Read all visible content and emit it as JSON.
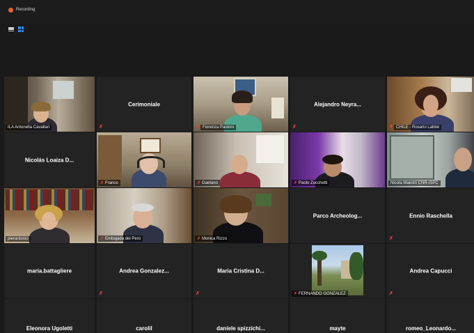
{
  "recording": {
    "label": "Recording"
  },
  "tiles": [
    {
      "name": "ILA Antonella Cavallari",
      "video": true,
      "active": true
    },
    {
      "name": "Cerimoniale",
      "video": false
    },
    {
      "name": "Fiorenza Paoloni",
      "video": true
    },
    {
      "name": "Alejandro Neyra...",
      "video": false
    },
    {
      "name": "CHILE - Rosario Labbé",
      "video": true
    },
    {
      "name": "Nicolás Loaiza D...",
      "video": false
    },
    {
      "name": "Franco",
      "video": true
    },
    {
      "name": "Gaetano",
      "video": true
    },
    {
      "name": "Paolo Zucchetti",
      "video": true
    },
    {
      "name": "Nicola Maestri CNR-ISPC",
      "video": true
    },
    {
      "name": "pierantonio",
      "video": true
    },
    {
      "name": "Embajada del Perú",
      "video": true
    },
    {
      "name": "Monica Rizzo",
      "video": true
    },
    {
      "name": "Parco Archeolog...",
      "video": false
    },
    {
      "name": "Ennio Raschella",
      "video": false
    },
    {
      "name": "maria.battagliere",
      "video": false
    },
    {
      "name": "Andrea Gonzalez...",
      "video": false
    },
    {
      "name": "Maria Cristina D...",
      "video": false
    },
    {
      "name": "FERNANDO GONZALEZ",
      "video": true
    },
    {
      "name": "Andrea Capucci",
      "video": false
    },
    {
      "name": "Eleonora Ugoletti",
      "video": false
    },
    {
      "name": "carolil",
      "video": false
    },
    {
      "name": "daniele spizzichi...",
      "video": false
    },
    {
      "name": "mayte",
      "video": false
    },
    {
      "name": "romeo_Leonardo...",
      "video": false
    }
  ]
}
